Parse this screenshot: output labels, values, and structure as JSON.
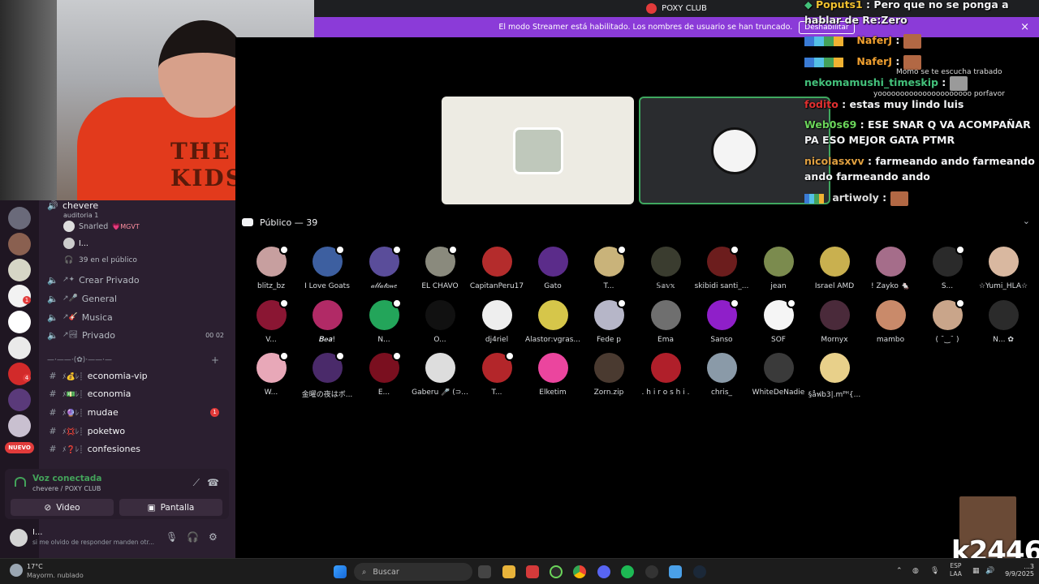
{
  "app": {
    "server_name": "POXY CLUB"
  },
  "streamer_banner": {
    "text": "El modo Streamer está habilitado. Los nombres de usuario se han truncado.",
    "button": "Deshabilitar",
    "close": "×"
  },
  "audience": {
    "header": "Público — 39"
  },
  "members": [
    {
      "name": "blitz_bz",
      "color": "#c79f9f"
    },
    {
      "name": "I Love Goats",
      "color": "#3d5fa0"
    },
    {
      "name": "𝒶𝓁𝓁𝒶𝓉𝑜𝓃𝑒",
      "color": "#5a4d9a"
    },
    {
      "name": "EL CHAVO",
      "color": "#8a8a7d"
    },
    {
      "name": "CapitanPeru17",
      "color": "#b42c2c"
    },
    {
      "name": "Gato",
      "color": "#5b2c8a"
    },
    {
      "name": "T...",
      "color": "#c9b37a"
    },
    {
      "name": "𝕊𝕒𝕧𝕩",
      "color": "#3a3c2f"
    },
    {
      "name": "skibidi santi_...",
      "color": "#6c1d1d"
    },
    {
      "name": "jean",
      "color": "#7b8b4e"
    },
    {
      "name": "Israel AMD",
      "color": "#c9b04f"
    },
    {
      "name": "! Zayko 🐁",
      "color": "#a56d8a"
    },
    {
      "name": "S...",
      "color": "#2a2a2a"
    },
    {
      "name": "☆Yumi_HLA☆",
      "color": "#d9b8a0"
    },
    {
      "name": "V...",
      "color": "#8a1633"
    },
    {
      "name": "𝑩𝒆𝒂!",
      "color": "#b12a66"
    },
    {
      "name": "N...",
      "color": "#23a55a"
    },
    {
      "name": "O...",
      "color": "#111111"
    },
    {
      "name": "dj4riel",
      "color": "#eeeeee"
    },
    {
      "name": "Alastor:vgras...",
      "color": "#d6c64a"
    },
    {
      "name": "Fede p",
      "color": "#b6b6c8"
    },
    {
      "name": "Ema",
      "color": "#6f6f6f"
    },
    {
      "name": "Sanso",
      "color": "#8f1fc9"
    },
    {
      "name": "SOF",
      "color": "#f5f5f5"
    },
    {
      "name": "Mornyx",
      "color": "#4a2a3a"
    },
    {
      "name": "mambo",
      "color": "#c98a6a"
    },
    {
      "name": "( ˘‿˘ )",
      "color": "#c9a58a"
    },
    {
      "name": "N... ✿",
      "color": "#2b2b2b"
    },
    {
      "name": "W...",
      "color": "#e8a8b8"
    },
    {
      "name": "金曜の夜はボ...",
      "color": "#4a2a6a"
    },
    {
      "name": "E...",
      "color": "#7a0f1f"
    },
    {
      "name": "Gaberu 🎤 (⊃...",
      "color": "#dddddd"
    },
    {
      "name": "T...",
      "color": "#b3262a"
    },
    {
      "name": "Elketim",
      "color": "#eb459e"
    },
    {
      "name": "Zorn.zip",
      "color": "#4a3a30"
    },
    {
      "name": ". h i r o s h i .",
      "color": "#b01f2a"
    },
    {
      "name": "chris_",
      "color": "#8a9aa8"
    },
    {
      "name": "WhiteDeNadie",
      "color": "#3a3a3a"
    },
    {
      "name": "§åฟb3|.mᴾᴴ{...",
      "color": "#e8d08a"
    }
  ],
  "sidebar": {
    "voice_channel": "chevere",
    "voice_subtitle": "auditoria 1",
    "speakers": [
      {
        "name": "Snarled",
        "tag": "💗MGVT"
      },
      {
        "name": "I..."
      }
    ],
    "audience_count": "39 en el público",
    "channels": [
      {
        "name": "Crear Privado",
        "prefix": "↗✦"
      },
      {
        "name": "General",
        "prefix": "↗🎤"
      },
      {
        "name": "Musica",
        "prefix": "↗🎸"
      },
      {
        "name": "Privado",
        "prefix": "↗🏞",
        "right": "00  02"
      }
    ],
    "divider": "—·——·(✿)·——·—",
    "text_channels": [
      {
        "name": "economia-vip",
        "prefix": "ﾒ💰ﾚ┊"
      },
      {
        "name": "economia",
        "prefix": "ﾒ💵ﾚ┊"
      },
      {
        "name": "mudae",
        "prefix": "ﾒ🔮ﾚ┊",
        "badge": "1"
      },
      {
        "name": "poketwo",
        "prefix": "ﾒ💢ﾚ┊"
      },
      {
        "name": "confesiones",
        "prefix": "ﾒ❓ﾚ┊"
      }
    ],
    "new_badge": "NUEVO",
    "guild_badges": [
      "1",
      "4"
    ]
  },
  "voice_panel": {
    "status": "Voz conectada",
    "location": "chevere / POXY CLUB",
    "video": "Video",
    "screen": "Pantalla"
  },
  "user": {
    "name": "I...",
    "status": "si me olvido de responder manden otr..."
  },
  "chat": [
    {
      "user": "Poputs1",
      "color": "#f0c030",
      "text": "Pero que no se ponga a hablar de Re:Zero"
    },
    {
      "user": "NaferJ",
      "color": "#f0a030",
      "text": ""
    },
    {
      "user": "NaferJ",
      "color": "#f0a030",
      "text": ""
    },
    {
      "user": "nekomamushi_timeskip",
      "color": "#43c07a",
      "text": ""
    },
    {
      "user": "fodito",
      "color": "#e03030",
      "text": "estas muy lindo luis"
    },
    {
      "user": "Web0s69",
      "color": "#6bd55a",
      "text": "ESE SNAR Q VA ACOMPAÑAR PA ESO MEJOR GATA PTMR"
    },
    {
      "user": "nicolasxvv",
      "color": "#e0a040",
      "text": "farmeando ando farmeando ando farmeando ando"
    },
    {
      "user": "artiwoly",
      "color": "#dddddd",
      "text": ""
    }
  ],
  "overlay_notes": [
    "Momo se te escucha trabado",
    "yooooooooooooooooooooo porfavor"
  ],
  "watermark": "k2446",
  "taskbar": {
    "temp": "17°C",
    "weather": "Mayorm. nublado",
    "search": "Buscar",
    "lang_top": "ESP",
    "lang_bottom": "LAA",
    "time": "...3",
    "date": "9/9/2025"
  }
}
